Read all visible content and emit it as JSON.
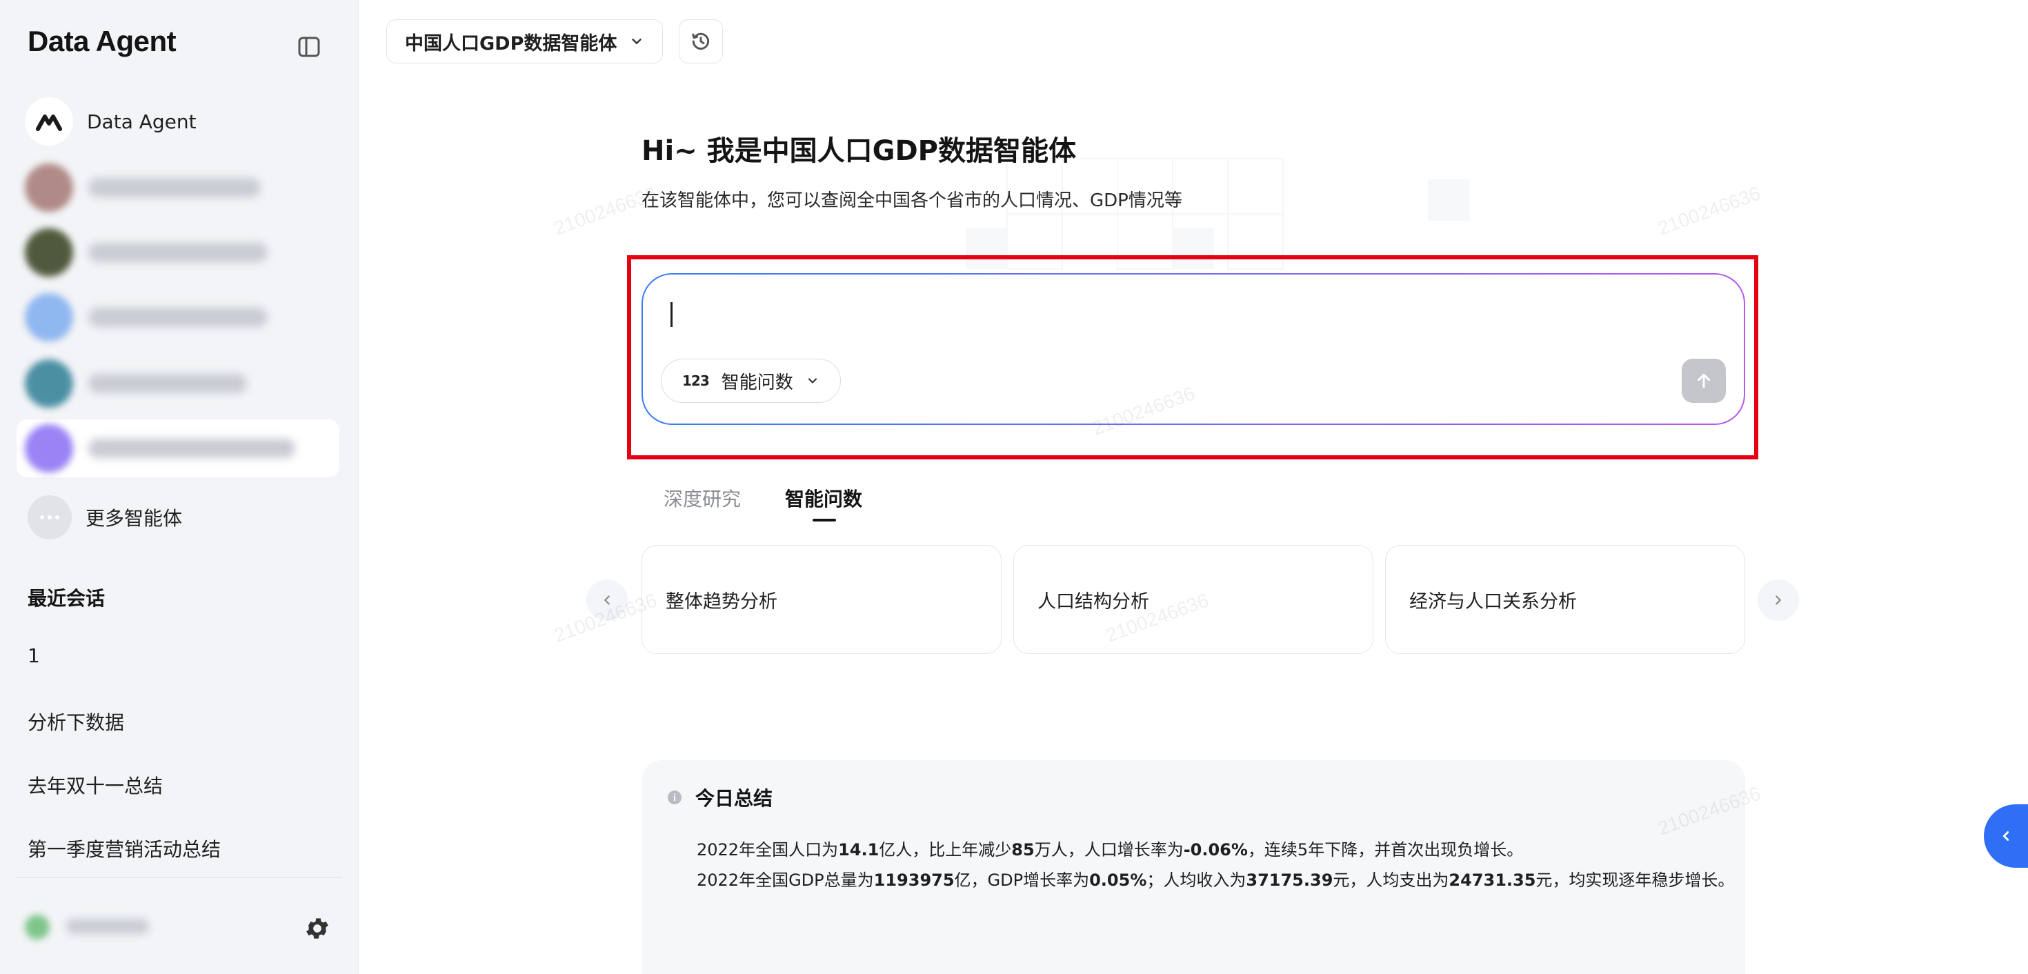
{
  "sidebar": {
    "brand": "Data Agent",
    "agents": [
      {
        "label": "Data Agent"
      }
    ],
    "more_agents": "更多智能体",
    "recent_title": "最近会话",
    "recent": [
      "1",
      "分析下数据",
      "去年双十一总结",
      "第一季度营销活动总结"
    ]
  },
  "header": {
    "agent_selector": "中国人口GDP数据智能体"
  },
  "main": {
    "greeting": "Hi~ 我是中国人口GDP数据智能体",
    "subtitle": "在该智能体中，您可以查阅全中国各个省市的人口情况、GDP情况等",
    "mode_icon": "123",
    "mode_label": "智能问数",
    "tabs": [
      "深度研究",
      "智能问数"
    ],
    "suggestions": [
      "整体趋势分析",
      "人口结构分析",
      "经济与人口关系分析"
    ]
  },
  "summary": {
    "title": "今日总结",
    "line1": {
      "a": "2022年全国人口为",
      "b": "14.1",
      "c": "亿人，比上年减少",
      "d": "85",
      "e": "万人，人口增长率为",
      "f": "-0.06%",
      "g": "，连续5年下降，并首次出现负增长。"
    },
    "line2": {
      "a": "2022年全国GDP总量为",
      "b": "1193975",
      "c": "亿，GDP增长率为",
      "d": "0.05%",
      "e": "；人均收入为",
      "f": "37175.39",
      "g": "元，人均支出为",
      "h": "24731.35",
      "i": "元，均实现逐年稳步增长。"
    }
  },
  "watermark": "2100246636",
  "colors": {
    "highlight": "#e60012",
    "accent": "#2f6ff5",
    "gradient_start": "#3a7bf6",
    "gradient_end": "#b558f0"
  }
}
